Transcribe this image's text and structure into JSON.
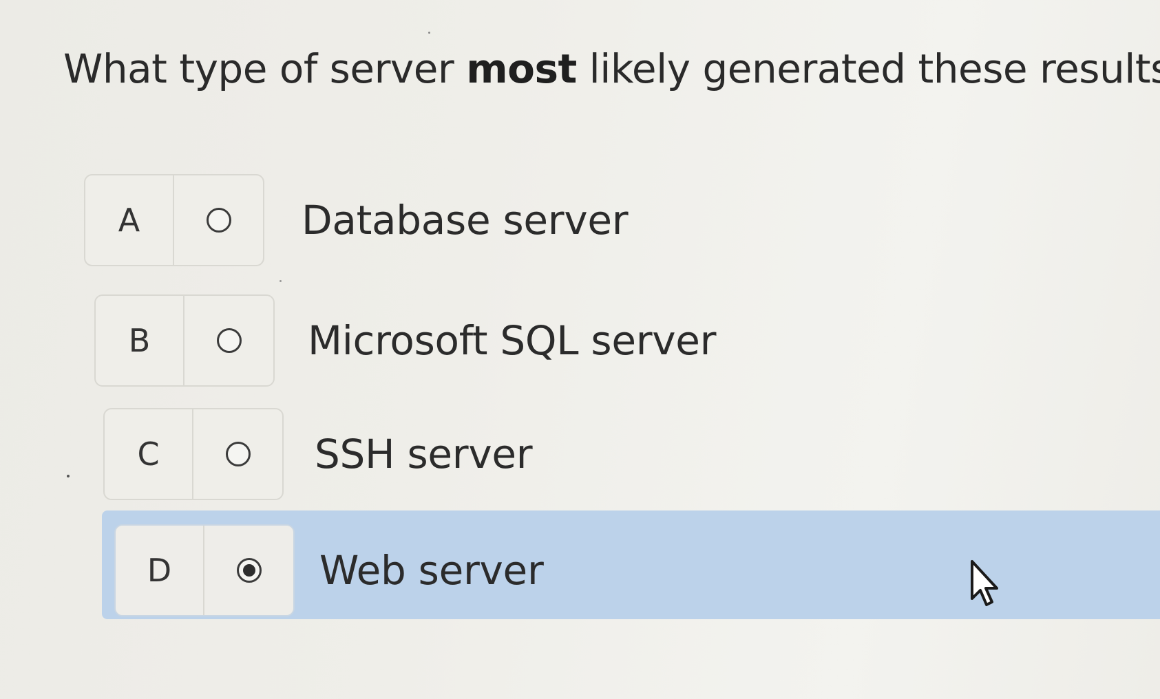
{
  "question": {
    "prefix": "What type of server ",
    "emphasis": "most",
    "suffix": " likely generated these results?"
  },
  "options": [
    {
      "letter": "A",
      "label": "Database server",
      "selected": false
    },
    {
      "letter": "B",
      "label": "Microsoft SQL server",
      "selected": false
    },
    {
      "letter": "C",
      "label": "SSH server",
      "selected": false
    },
    {
      "letter": "D",
      "label": "Web server",
      "selected": true
    }
  ],
  "colors": {
    "selected_highlight": "#bcd2ea",
    "background": "#efeee9"
  },
  "icons": {
    "radio_unselected": "radio-empty-icon",
    "radio_selected": "radio-filled-icon",
    "cursor": "mouse-pointer-icon"
  }
}
